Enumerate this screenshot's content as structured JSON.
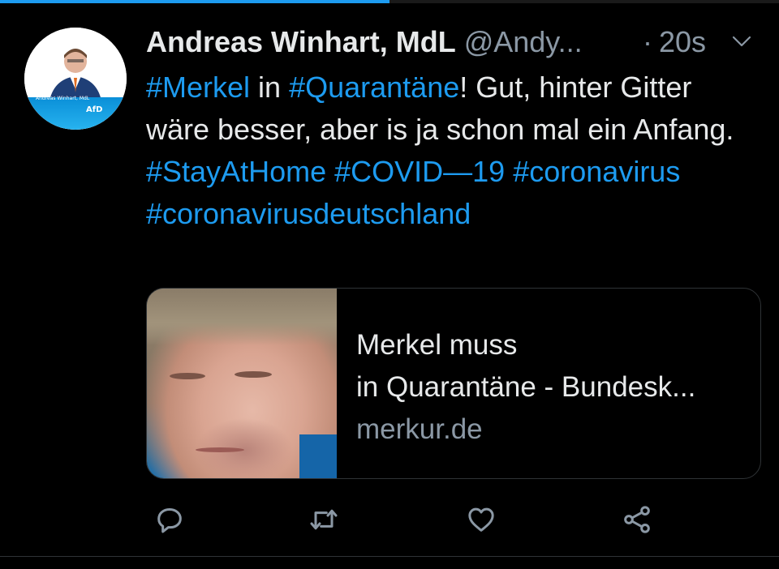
{
  "progress": {
    "value": 0.5,
    "color": "#1d9bf0"
  },
  "avatar": {
    "name": "Andreas Winhart, MdL",
    "party": "AfD"
  },
  "tweet": {
    "display_name": "Andreas Winhart, MdL",
    "handle": "@Andy...",
    "dot": "·",
    "time": "20s",
    "text_parts": [
      {
        "text": "#Merkel",
        "tag": true
      },
      {
        "text": " in ",
        "tag": false
      },
      {
        "text": "#Quarantäne",
        "tag": true
      },
      {
        "text": "! Gut, hinter Gitter wäre besser, aber is ja schon mal ein Anfang.",
        "tag": false
      },
      {
        "text": "#StayAtHome",
        "tag": true
      },
      {
        "text": " ",
        "tag": false
      },
      {
        "text": "#COVID—19",
        "tag": true
      },
      {
        "text": " ",
        "tag": false
      },
      {
        "text": "#coronavirus",
        "tag": true
      },
      {
        "text": "#coronavirusdeutschland",
        "tag": true
      }
    ]
  },
  "card": {
    "title_line1": "Merkel muss",
    "title_line2": "in Quarantäne - Bundesk...",
    "domain": "merkur.de"
  },
  "actions": {
    "reply": "reply-icon",
    "retweet": "retweet-icon",
    "like": "heart-icon",
    "share": "share-icon"
  },
  "colors": {
    "link": "#1d9bf0",
    "muted": "#8b98a5",
    "text": "#e7e9ea",
    "background": "#000000"
  }
}
